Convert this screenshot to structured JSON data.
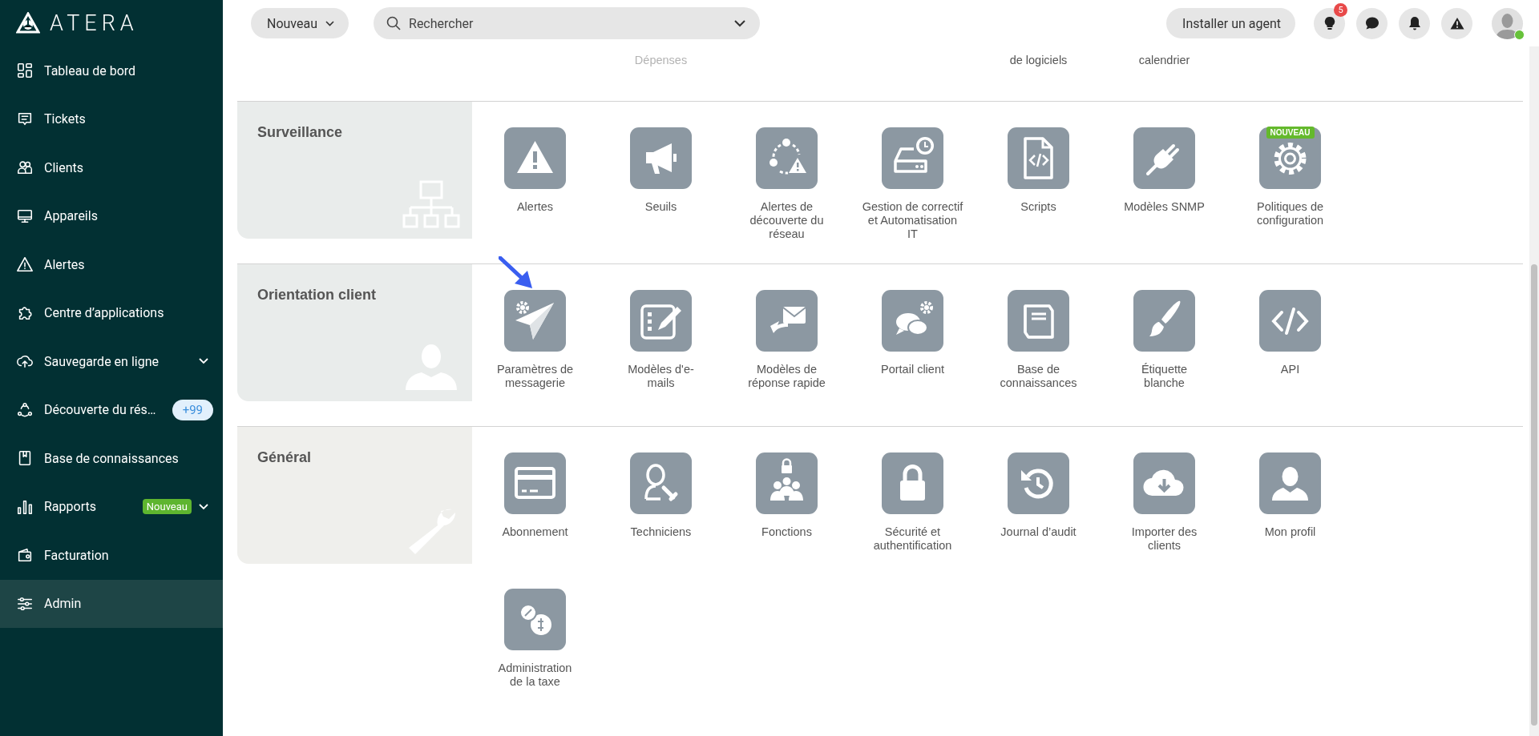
{
  "logo": {
    "text": "ATERA"
  },
  "sidebar": {
    "items": [
      {
        "label": "Tableau de bord",
        "selected": false,
        "expandable": false
      },
      {
        "label": "Tickets",
        "selected": false,
        "expandable": false
      },
      {
        "label": "Clients",
        "selected": false,
        "expandable": false
      },
      {
        "label": "Appareils",
        "selected": false,
        "expandable": false
      },
      {
        "label": "Alertes",
        "selected": false,
        "expandable": false
      },
      {
        "label": "Centre d’applications",
        "selected": false,
        "expandable": false
      },
      {
        "label": "Sauvegarde en ligne",
        "selected": false,
        "expandable": true
      },
      {
        "label": "Découverte du rés…",
        "selected": false,
        "expandable": false,
        "count": "+99"
      },
      {
        "label": "Base de connaissances",
        "selected": false,
        "expandable": false
      },
      {
        "label": "Rapports",
        "selected": false,
        "expandable": true,
        "badge": "Nouveau"
      },
      {
        "label": "Facturation",
        "selected": false,
        "expandable": false
      },
      {
        "label": "Admin",
        "selected": true,
        "expandable": false
      }
    ]
  },
  "topbar": {
    "new_button": "Nouveau",
    "search": {
      "placeholder": "Rechercher"
    },
    "install_button": "Installer un agent",
    "notifications": "5",
    "online": true
  },
  "top_row": [
    {
      "label": "Dépenses",
      "disabled": true
    },
    {
      "label": "de logiciels",
      "disabled": false
    },
    {
      "label": "calendrier",
      "disabled": false
    }
  ],
  "sections": [
    {
      "title": "Surveillance",
      "tiles": [
        {
          "label": "Alertes"
        },
        {
          "label": "Seuils"
        },
        {
          "label": "Alertes de\ndécouverte du\nréseau"
        },
        {
          "label": "Gestion de correctif\net Automatisation\nIT"
        },
        {
          "label": "Scripts"
        },
        {
          "label": "Modèles SNMP"
        },
        {
          "label": "Politiques de\nconfiguration",
          "badge": "NOUVEAU"
        }
      ]
    },
    {
      "title": "Orientation client",
      "tiles": [
        {
          "label": "Paramètres de\nmessagerie",
          "pointed": true
        },
        {
          "label": "Modèles d'e-\nmails"
        },
        {
          "label": "Modèles de\nréponse rapide"
        },
        {
          "label": "Portail client"
        },
        {
          "label": "Base de\nconnaissances"
        },
        {
          "label": "Étiquette\nblanche"
        },
        {
          "label": "API"
        }
      ]
    },
    {
      "title": "Général",
      "tiles": [
        {
          "label": "Abonnement"
        },
        {
          "label": "Techniciens"
        },
        {
          "label": "Fonctions"
        },
        {
          "label": "Sécurité et\nauthentification"
        },
        {
          "label": "Journal d’audit"
        },
        {
          "label": "Importer des\nclients"
        },
        {
          "label": "Mon profil"
        },
        {
          "label": "Administration\nde la taxe"
        }
      ]
    }
  ]
}
